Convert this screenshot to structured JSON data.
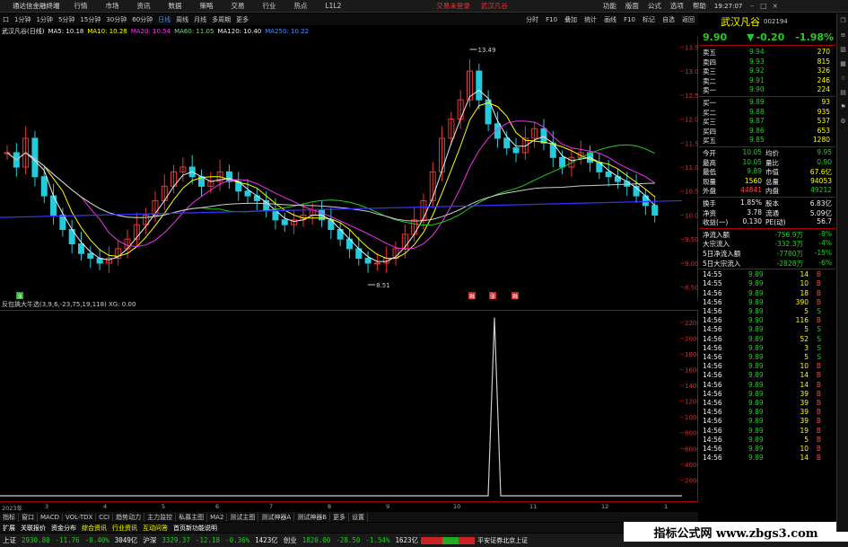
{
  "menubar": {
    "app_title": "通达信金融终端",
    "items": [
      "行情",
      "市场",
      "资讯",
      "数据",
      "策略",
      "交易",
      "行业",
      "热点",
      "L1L2"
    ],
    "center_links": [
      "交易未登录",
      "武汉凡谷"
    ],
    "right_items": [
      "功能",
      "版面",
      "公式",
      "选项",
      "帮助"
    ],
    "clock": "19:27:07"
  },
  "toolbar": {
    "left_icon": "口",
    "periods": [
      "1分钟",
      "1分钟",
      "5分钟",
      "15分钟",
      "30分钟",
      "60分钟",
      "日线",
      "周线",
      "月线",
      "多周期",
      "更多"
    ],
    "active_period": "日线",
    "right_items": [
      "分时",
      "F10",
      "叠加",
      "统计",
      "画线",
      "F10",
      "标记",
      "自选",
      "返回"
    ]
  },
  "title_line": {
    "stock": "武汉凡谷(日线)",
    "ma5": "MA5: 10.18",
    "ma10": "MA10: 10.28",
    "ma20": "MA20: 10.54",
    "ma60": "MA60: 11.05",
    "ma120": "MA120: 10.40",
    "ma250": "MA250: 10.22",
    "high_label": "13.49",
    "low_label": "8.51",
    "markers": [
      "涨",
      "融",
      "涨",
      "融"
    ]
  },
  "price_axis": [
    "13.50",
    "13.00",
    "12.50",
    "12.00",
    "11.50",
    "11.00",
    "10.50",
    "10.00",
    "9.50",
    "9.00",
    "8.50"
  ],
  "sub_title": "反包擒大牛选(3,9,6,-23,75,19,118) XG: 0.00",
  "sub_axis": [
    "22000",
    "20000",
    "18000",
    "16000",
    "14000",
    "12000",
    "10000",
    "8000",
    "6000",
    "4000",
    "2000"
  ],
  "date_axis": [
    "2023年",
    "3",
    "4",
    "5",
    "6",
    "7",
    "8",
    "9",
    "10",
    "11",
    "12",
    "1"
  ],
  "tabs_row1": [
    "指标",
    "窗口",
    "MACD",
    "VOL-TDX",
    "CCI",
    "趋势动力",
    "主力监控",
    "私募主图",
    "MA2",
    "测试主图",
    "测试神器A",
    "测试神器B",
    "更多",
    "设置"
  ],
  "tabs_row2": [
    "扩展",
    "关联报价",
    "资金分布",
    "综合资讯",
    "行业资讯",
    "互动问答",
    "首页新功能说明"
  ],
  "status": {
    "sh_label": "上证",
    "sh_val": "2930.80",
    "sh_chg": "-11.76",
    "sh_pct": "-0.40%",
    "sh_amt": "3049亿",
    "sz_label": "沪深",
    "sz_val": "3329.37",
    "sz_chg": "-12.18",
    "sz_pct": "-0.36%",
    "sz_amt": "1423亿",
    "cy_label": "创业",
    "cy_val": "1820.00",
    "cy_chg": "-28.50",
    "cy_pct": "-1.54%",
    "cy_amt": "1623亿",
    "broker": "平安证券北京上证"
  },
  "watermark": "指标公式网 www.zbgs3.com",
  "quote": {
    "name": "武汉凡谷",
    "code": "002194",
    "price": "9.90",
    "change": "-0.20",
    "pct": "-1.98%",
    "asks": [
      {
        "label": "卖五",
        "price": "9.94",
        "vol": "270"
      },
      {
        "label": "卖四",
        "price": "9.93",
        "vol": "815"
      },
      {
        "label": "卖三",
        "price": "9.92",
        "vol": "326"
      },
      {
        "label": "卖二",
        "price": "9.91",
        "vol": "246"
      },
      {
        "label": "卖一",
        "price": "9.90",
        "vol": "224"
      }
    ],
    "bids": [
      {
        "label": "买一",
        "price": "9.89",
        "vol": "93"
      },
      {
        "label": "买二",
        "price": "9.88",
        "vol": "935"
      },
      {
        "label": "买三",
        "price": "9.87",
        "vol": "537"
      },
      {
        "label": "买四",
        "price": "9.86",
        "vol": "653"
      },
      {
        "label": "买五",
        "price": "9.85",
        "vol": "1280"
      }
    ],
    "stats": [
      {
        "l1": "今开",
        "v1": "10.05",
        "l2": "均价",
        "v2": "9.95"
      },
      {
        "l1": "最高",
        "v1": "10.05",
        "l2": "量比",
        "v2": "0.90"
      },
      {
        "l1": "最低",
        "v1": "9.89",
        "l2": "市值",
        "v2": "67.6亿"
      },
      {
        "l1": "现量",
        "v1": "1560",
        "l2": "总量",
        "v2": "94053"
      },
      {
        "l1": "外盘",
        "v1": "44841",
        "l2": "内盘",
        "v2": "49212"
      },
      {
        "l1": "换手",
        "v1": "1.85%",
        "l2": "股本",
        "v2": "6.83亿"
      },
      {
        "l1": "净资",
        "v1": "3.78",
        "l2": "流通",
        "v2": "5.09亿"
      },
      {
        "l1": "收益(一)",
        "v1": "0.130",
        "l2": "PE(动)",
        "v2": "56.7"
      }
    ],
    "flows": [
      {
        "label": "净流入额",
        "val": "-756.9万",
        "pct": "-8%"
      },
      {
        "label": "大宗流入",
        "val": "-332.3万",
        "pct": "-4%"
      },
      {
        "label": "5日净流入额",
        "val": "-7780万",
        "pct": "-15%"
      },
      {
        "label": "5日大宗流入",
        "val": "-2828万",
        "pct": "-6%"
      }
    ],
    "ticks": [
      {
        "t": "14:55",
        "p": "9.89",
        "v": "14",
        "d": "B"
      },
      {
        "t": "14:55",
        "p": "9.89",
        "v": "10",
        "d": "B"
      },
      {
        "t": "14:56",
        "p": "9.89",
        "v": "18",
        "d": "B"
      },
      {
        "t": "14:56",
        "p": "9.89",
        "v": "390",
        "d": "B"
      },
      {
        "t": "14:56",
        "p": "9.89",
        "v": "5",
        "d": "S"
      },
      {
        "t": "14:56",
        "p": "9.90",
        "v": "116",
        "d": "B"
      },
      {
        "t": "14:56",
        "p": "9.89",
        "v": "5",
        "d": "S"
      },
      {
        "t": "14:56",
        "p": "9.89",
        "v": "52",
        "d": "S"
      },
      {
        "t": "14:56",
        "p": "9.89",
        "v": "3",
        "d": "S"
      },
      {
        "t": "14:56",
        "p": "9.89",
        "v": "5",
        "d": "S"
      },
      {
        "t": "14:56",
        "p": "9.89",
        "v": "10",
        "d": "B"
      },
      {
        "t": "14:56",
        "p": "9.89",
        "v": "14",
        "d": "B"
      },
      {
        "t": "14:56",
        "p": "9.89",
        "v": "14",
        "d": "B"
      },
      {
        "t": "14:56",
        "p": "9.89",
        "v": "39",
        "d": "B"
      },
      {
        "t": "14:56",
        "p": "9.89",
        "v": "39",
        "d": "B"
      },
      {
        "t": "14:56",
        "p": "9.89",
        "v": "39",
        "d": "B"
      },
      {
        "t": "14:56",
        "p": "9.89",
        "v": "39",
        "d": "B"
      },
      {
        "t": "14:56",
        "p": "9.89",
        "v": "19",
        "d": "B"
      },
      {
        "t": "14:56",
        "p": "9.89",
        "v": "5",
        "d": "B"
      },
      {
        "t": "14:56",
        "p": "9.89",
        "v": "10",
        "d": "B"
      },
      {
        "t": "14:56",
        "p": "9.89",
        "v": "14",
        "d": "B"
      }
    ]
  },
  "side_icons": [
    "bookmark-icon",
    "list-icon",
    "chart-icon",
    "grid-icon",
    "star-icon",
    "news-icon",
    "flag-icon",
    "settings-icon"
  ]
}
